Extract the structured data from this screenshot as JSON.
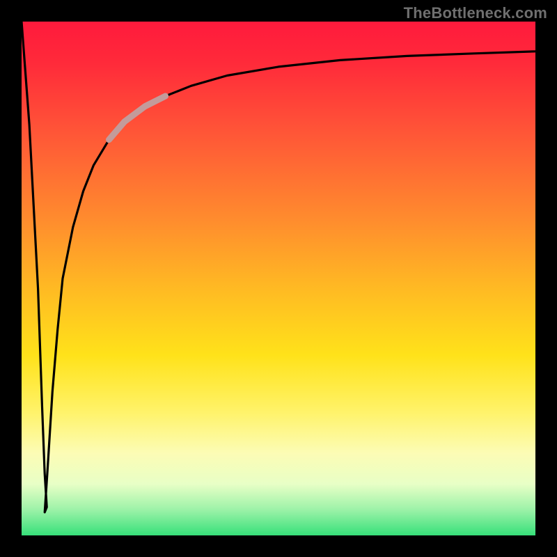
{
  "watermark": "TheBottleneck.com",
  "colors": {
    "frame": "#000000",
    "curve": "#000000",
    "highlight": "#c39b9b",
    "gradient_top": "#ff1a3c",
    "gradient_bottom": "#37e07a"
  },
  "chart_data": {
    "type": "line",
    "title": "",
    "xlabel": "",
    "ylabel": "",
    "xlim": [
      0,
      100
    ],
    "ylim": [
      0,
      100
    ],
    "grid": false,
    "legend": false,
    "annotations": [
      {
        "text": "TheBottleneck.com",
        "position": "top-right"
      }
    ],
    "series": [
      {
        "name": "curve",
        "color": "#000000",
        "x": [
          0.0,
          1.5,
          3.2,
          4.0,
          4.5,
          4.9,
          4.5,
          5.0,
          6.0,
          7.0,
          8.0,
          10.0,
          12.0,
          14.0,
          17.0,
          20.0,
          24.0,
          28.0,
          33.0,
          40.0,
          50.0,
          62.0,
          75.0,
          88.0,
          100.0
        ],
        "values": [
          100.0,
          80.0,
          48.0,
          25.0,
          12.0,
          5.5,
          4.5,
          12.0,
          28.0,
          40.0,
          50.0,
          60.0,
          67.0,
          72.0,
          77.0,
          80.5,
          83.5,
          85.5,
          87.5,
          89.5,
          91.2,
          92.5,
          93.3,
          93.8,
          94.2
        ]
      },
      {
        "name": "highlight-segment",
        "color": "#c39b9b",
        "x": [
          17.0,
          20.0,
          24.0,
          28.0
        ],
        "values": [
          77.0,
          80.5,
          83.5,
          85.5
        ]
      }
    ],
    "note": "Values estimated from pixel positions; axes are unlabeled in source image so a 0–100 normalized scale is used."
  }
}
